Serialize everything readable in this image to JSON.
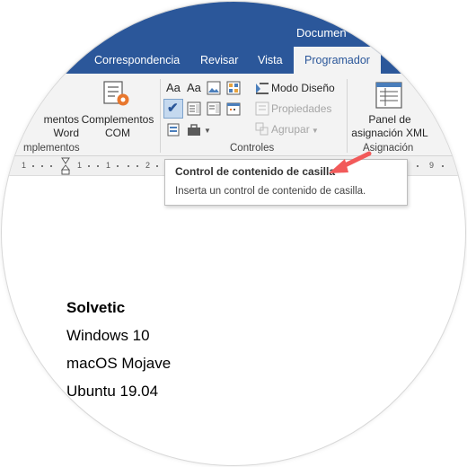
{
  "title_bar": {
    "document_title": "Documen"
  },
  "tabs": [
    {
      "label": "Correspondencia"
    },
    {
      "label": "Revisar"
    },
    {
      "label": "Vista"
    },
    {
      "label": "Programador",
      "active": true
    }
  ],
  "ribbon": {
    "complementos_group": {
      "partial_button_line1": "mentos",
      "partial_button_line2": "Word",
      "com_button_line1": "Complementos",
      "com_button_line2": "COM",
      "label": "mplementos"
    },
    "controles_group": {
      "modo_diseno": "Modo Diseño",
      "propiedades": "Propiedades",
      "agrupar": "Agrupar",
      "label": "Controles"
    },
    "asignacion_group": {
      "panel_line1": "Panel de",
      "panel_line2": "asignación XML",
      "label": "Asignación"
    }
  },
  "ruler": {
    "numbers": [
      "1",
      "1",
      "1",
      "2",
      "9"
    ]
  },
  "tooltip": {
    "title": "Control de contenido de casilla",
    "description": "Inserta un control de contenido de casilla."
  },
  "document": {
    "lines": [
      "Solvetic",
      "Windows 10",
      "macOS Mojave",
      "Ubuntu 19.04"
    ]
  },
  "colors": {
    "ribbon_blue": "#2b579a",
    "arrow_red": "#f25a5a"
  }
}
